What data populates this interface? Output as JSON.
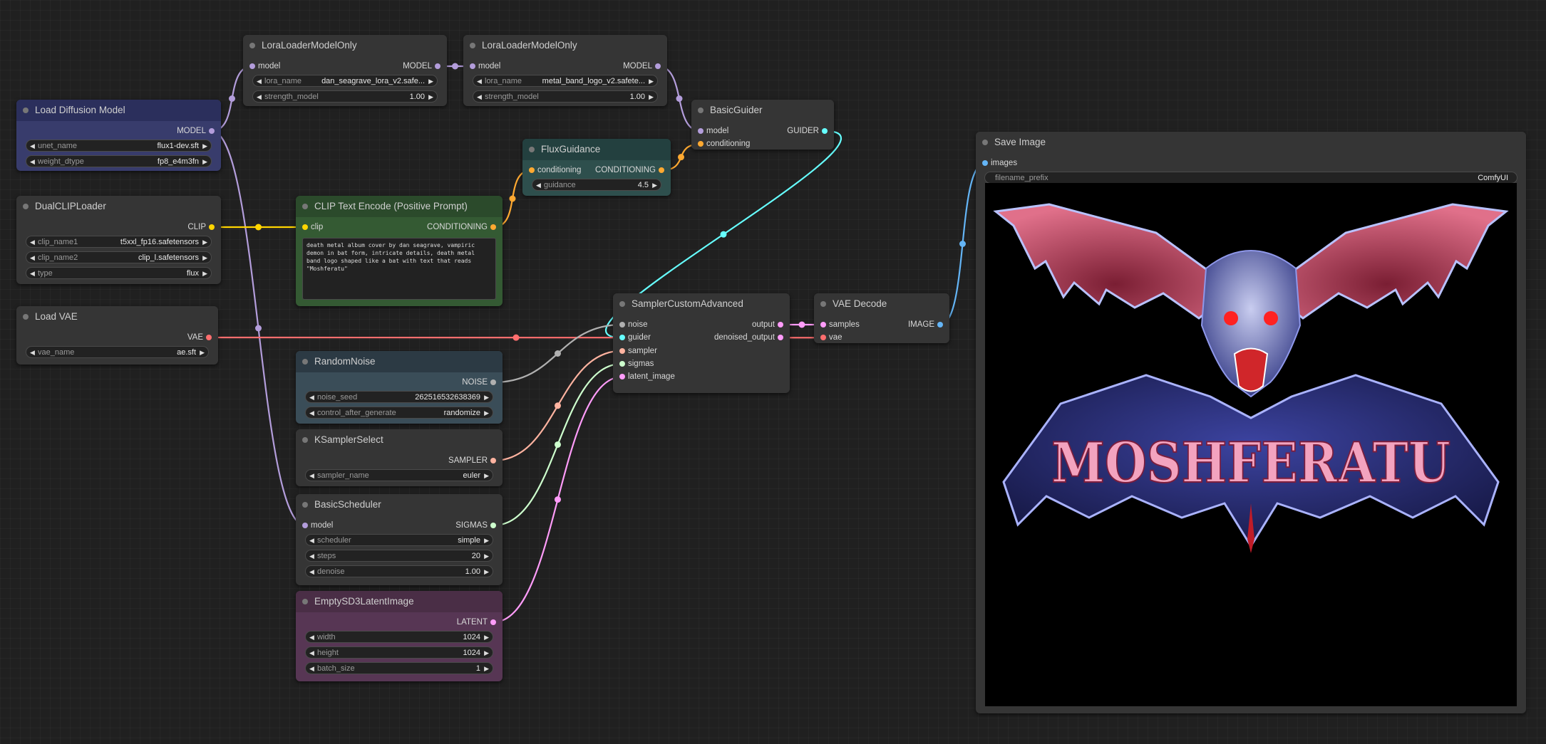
{
  "nodes": {
    "lora1": {
      "title": "LoraLoaderModelOnly",
      "inputs": [
        "model"
      ],
      "outputs": [
        "MODEL"
      ],
      "widgets": [
        {
          "label": "lora_name",
          "value": "dan_seagrave_lora_v2.safe..."
        },
        {
          "label": "strength_model",
          "value": "1.00"
        }
      ]
    },
    "lora2": {
      "title": "LoraLoaderModelOnly",
      "inputs": [
        "model"
      ],
      "outputs": [
        "MODEL"
      ],
      "widgets": [
        {
          "label": "lora_name",
          "value": "metal_band_logo_v2.safete..."
        },
        {
          "label": "strength_model",
          "value": "1.00"
        }
      ]
    },
    "load_diffusion": {
      "title": "Load Diffusion Model",
      "outputs": [
        "MODEL"
      ],
      "widgets": [
        {
          "label": "unet_name",
          "value": "flux1-dev.sft"
        },
        {
          "label": "weight_dtype",
          "value": "fp8_e4m3fn"
        }
      ]
    },
    "basic_guider": {
      "title": "BasicGuider",
      "inputs": [
        "model",
        "conditioning"
      ],
      "outputs": [
        "GUIDER"
      ]
    },
    "flux_guidance": {
      "title": "FluxGuidance",
      "inputs": [
        "conditioning"
      ],
      "outputs": [
        "CONDITIONING"
      ],
      "widgets": [
        {
          "label": "guidance",
          "value": "4.5"
        }
      ]
    },
    "dual_clip": {
      "title": "DualCLIPLoader",
      "outputs": [
        "CLIP"
      ],
      "widgets": [
        {
          "label": "clip_name1",
          "value": "t5xxl_fp16.safetensors"
        },
        {
          "label": "clip_name2",
          "value": "clip_l.safetensors"
        },
        {
          "label": "type",
          "value": "flux"
        }
      ]
    },
    "clip_text": {
      "title": "CLIP Text Encode (Positive Prompt)",
      "inputs": [
        "clip"
      ],
      "outputs": [
        "CONDITIONING"
      ],
      "text": "death metal album cover by dan seagrave, vampiric demon in bat form, intricate details, death metal band logo shaped like a bat with text that reads \"Moshferatu\""
    },
    "load_vae": {
      "title": "Load VAE",
      "outputs": [
        "VAE"
      ],
      "widgets": [
        {
          "label": "vae_name",
          "value": "ae.sft"
        }
      ]
    },
    "sampler_custom": {
      "title": "SamplerCustomAdvanced",
      "inputs": [
        "noise",
        "guider",
        "sampler",
        "sigmas",
        "latent_image"
      ],
      "outputs": [
        "output",
        "denoised_output"
      ]
    },
    "vae_decode": {
      "title": "VAE Decode",
      "inputs": [
        "samples",
        "vae"
      ],
      "outputs": [
        "IMAGE"
      ]
    },
    "random_noise": {
      "title": "RandomNoise",
      "outputs": [
        "NOISE"
      ],
      "widgets": [
        {
          "label": "noise_seed",
          "value": "262516532638369"
        },
        {
          "label": "control_after_generate",
          "value": "randomize"
        }
      ]
    },
    "ksampler_select": {
      "title": "KSamplerSelect",
      "outputs": [
        "SAMPLER"
      ],
      "widgets": [
        {
          "label": "sampler_name",
          "value": "euler"
        }
      ]
    },
    "basic_scheduler": {
      "title": "BasicScheduler",
      "inputs": [
        "model"
      ],
      "outputs": [
        "SIGMAS"
      ],
      "widgets": [
        {
          "label": "scheduler",
          "value": "simple"
        },
        {
          "label": "steps",
          "value": "20"
        },
        {
          "label": "denoise",
          "value": "1.00"
        }
      ]
    },
    "empty_latent": {
      "title": "EmptySD3LatentImage",
      "outputs": [
        "LATENT"
      ],
      "widgets": [
        {
          "label": "width",
          "value": "1024"
        },
        {
          "label": "height",
          "value": "1024"
        },
        {
          "label": "batch_size",
          "value": "1"
        }
      ]
    },
    "save_image": {
      "title": "Save Image",
      "inputs": [
        "images"
      ],
      "widgets": [
        {
          "label": "filename_prefix",
          "value": "ComfyUI"
        }
      ],
      "preview_text": "MOSHFERATU"
    }
  },
  "colors": {
    "model": "#b39ddb",
    "clip": "#ffd500",
    "conditioning": "#ffa931",
    "vae": "#ff6e6e",
    "latent": "#ff9cf9",
    "image": "#64b5f6",
    "guider": "#66ffff",
    "noise": "#b0b0b0",
    "sampler": "#ffb3a0",
    "sigmas": "#cdffcd"
  }
}
